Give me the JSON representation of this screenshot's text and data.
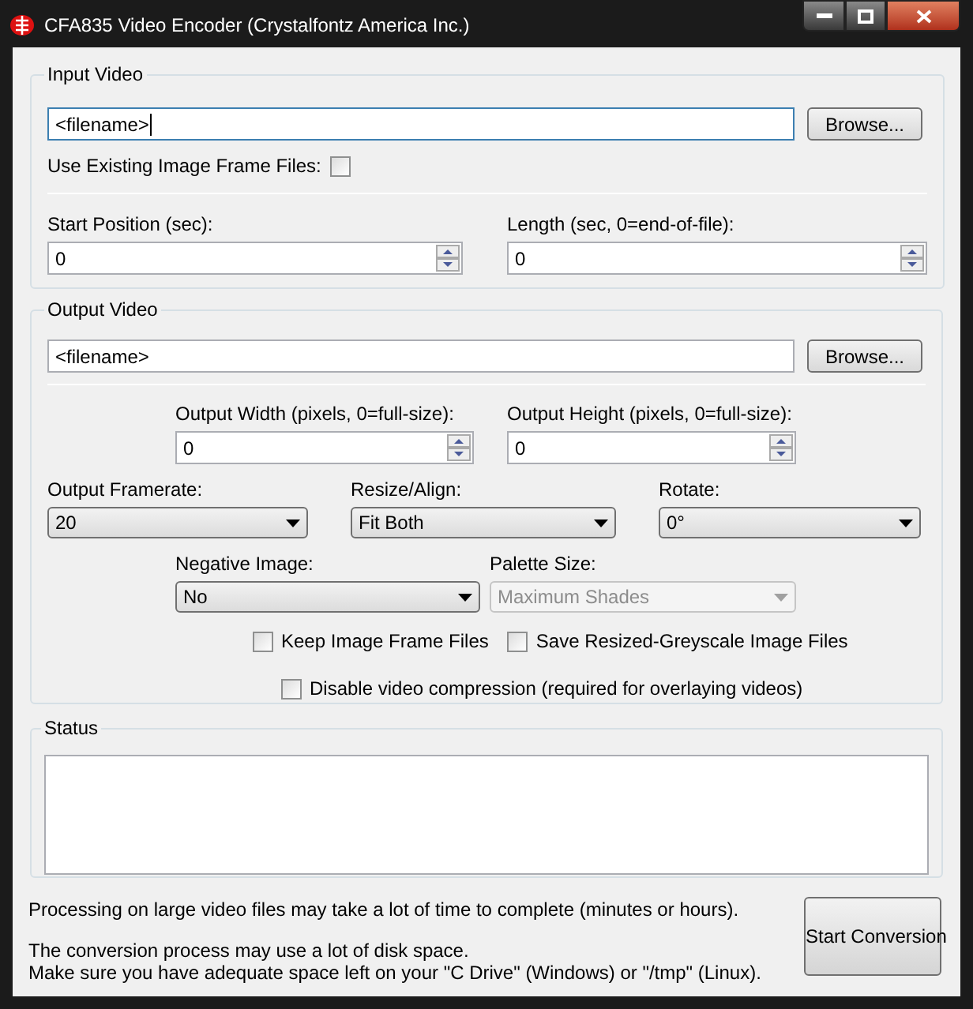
{
  "window": {
    "title": "CFA835 Video Encoder (Crystalfontz America Inc.)"
  },
  "input_video": {
    "title": "Input Video",
    "file_field": {
      "value": "<filename>",
      "focused": true
    },
    "browse_button": "Browse...",
    "use_existing": {
      "label": "Use Existing Image Frame Files:",
      "checked": false
    },
    "start_position": {
      "label": "Start Position (sec):",
      "value": "0"
    },
    "length": {
      "label": "Length (sec, 0=end-of-file):",
      "value": "0"
    }
  },
  "output_video": {
    "title": "Output Video",
    "file_field": {
      "value": "<filename>",
      "focused": false
    },
    "browse_button": "Browse...",
    "width": {
      "label": "Output Width (pixels, 0=full-size):",
      "value": "0"
    },
    "height": {
      "label": "Output Height (pixels, 0=full-size):",
      "value": "0"
    },
    "framerate": {
      "label": "Output Framerate:",
      "value": "20",
      "disabled": false
    },
    "resize": {
      "label": "Resize/Align:",
      "value": "Fit Both",
      "disabled": false
    },
    "rotate": {
      "label": "Rotate:",
      "value": "0°",
      "disabled": false
    },
    "negative": {
      "label": "Negative Image:",
      "value": "No",
      "disabled": false
    },
    "palette": {
      "label": "Palette Size:",
      "value": "Maximum Shades",
      "disabled": true
    },
    "checkboxes": [
      {
        "label": "Keep Image Frame Files",
        "checked": false
      },
      {
        "label": "Save Resized-Greyscale Image Files",
        "checked": false
      },
      {
        "label": "Disable video compression (required for overlaying videos)",
        "checked": false
      }
    ]
  },
  "status": {
    "title": "Status"
  },
  "notes": [
    "Processing on large video files may take a lot of time to complete (minutes or hours).",
    "The conversion process may use a lot of disk space.",
    "Make sure you have adequate space left on your \"C Drive\" (Windows) or \"/tmp\" (Linux)."
  ],
  "start_button": "Start Conversion"
}
